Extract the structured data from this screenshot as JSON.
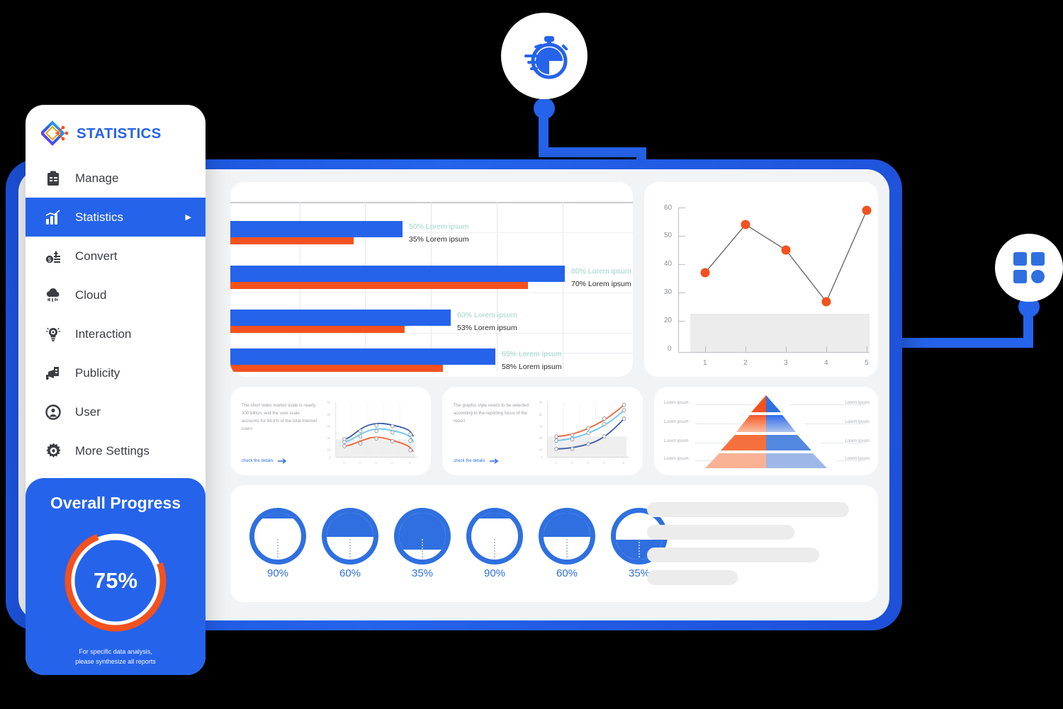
{
  "brand": {
    "name": "STATISTICS",
    "logo_icon": "diamond-circuit-logo"
  },
  "sidebar": {
    "items": [
      {
        "label": "Manage",
        "icon": "clipboard-icon",
        "active": false
      },
      {
        "label": "Statistics",
        "icon": "bar-chart-icon",
        "active": true
      },
      {
        "label": "Convert",
        "icon": "exchange-money-icon",
        "active": false
      },
      {
        "label": "Cloud",
        "icon": "cloud-rain-icon",
        "active": false
      },
      {
        "label": "Interaction",
        "icon": "lightbulb-gear-icon",
        "active": false
      },
      {
        "label": "Publicity",
        "icon": "megaphone-chart-icon",
        "active": false
      },
      {
        "label": "User",
        "icon": "user-circle-icon",
        "active": false
      },
      {
        "label": "More Settings",
        "icon": "gear-icon",
        "active": false
      }
    ],
    "progress": {
      "title": "Overall Progress",
      "value": "75%",
      "percent": 75,
      "note_line1": "For specific data analysis,",
      "note_line2": "please synthesize all reports",
      "ring_color": "#f4511e",
      "track_color": "#ffffff"
    }
  },
  "badges": [
    {
      "name": "stopwatch-icon",
      "position": "top"
    },
    {
      "name": "grid-apps-icon",
      "position": "right"
    }
  ],
  "colors": {
    "brand_blue": "#2563eb",
    "frame_blue": "#1b4fd6",
    "accent_orange": "#f4511e",
    "screen_bg": "#f2f3f5"
  },
  "chart_data": [
    {
      "type": "bar",
      "orientation": "horizontal",
      "title": "",
      "grid": true,
      "series": [
        {
          "name": "primary",
          "color": "#2563eb",
          "values": [
            50,
            80,
            60,
            65
          ]
        },
        {
          "name": "secondary",
          "color": "#f4511e",
          "values": [
            35,
            70,
            53,
            58
          ]
        }
      ],
      "labels_top": [
        "50% Lorem ipsum",
        "80% Lorem ipsum",
        "60% Lorem ipsum",
        "65% Lorem ipsum"
      ],
      "labels_bottom": [
        "35% Lorem ipsum",
        "70% Lorem ipsum",
        "53% Lorem ipsum",
        "58% Lorem ipsum"
      ],
      "xlim": [
        0,
        100
      ]
    },
    {
      "type": "line",
      "title": "",
      "x": [
        1,
        2,
        3,
        4,
        5
      ],
      "values": [
        30,
        50,
        40,
        21,
        57
      ],
      "marker_color": "#f4511e",
      "line_color": "#6b6b6b",
      "yticks": [
        "0",
        "20",
        "30",
        "40",
        "50",
        "60"
      ],
      "xticks": [
        "1",
        "2",
        "3",
        "4",
        "5"
      ],
      "ylim": [
        0,
        60
      ],
      "band": {
        "from": 4,
        "to": 25
      }
    },
    {
      "type": "line",
      "title": "",
      "x": [
        1,
        2,
        3,
        4,
        5
      ],
      "series": [
        {
          "name": "series-a",
          "color": "#3f5fae",
          "values": [
            32,
            42,
            48,
            47,
            38
          ]
        },
        {
          "name": "series-b",
          "color": "#6fc6ef",
          "values": [
            28,
            36,
            44,
            42,
            33
          ]
        },
        {
          "name": "series-c",
          "color": "#ef6a3c",
          "values": [
            26,
            29,
            35,
            31,
            22
          ]
        }
      ],
      "yticks": [
        "0",
        "20",
        "30",
        "40",
        "50",
        "60"
      ],
      "xticks": [
        "1",
        "2",
        "3",
        "4",
        "5"
      ]
    },
    {
      "type": "line",
      "title": "",
      "x": [
        1,
        2,
        3,
        4,
        5
      ],
      "series": [
        {
          "name": "series-a",
          "color": "#ef6a3c",
          "values": [
            22,
            24,
            33,
            44,
            58
          ]
        },
        {
          "name": "series-b",
          "color": "#6fc6ef",
          "values": [
            18,
            20,
            27,
            38,
            52
          ]
        },
        {
          "name": "series-c",
          "color": "#3f5fae",
          "values": [
            10,
            10,
            16,
            26,
            46
          ]
        }
      ],
      "yticks": [
        "0",
        "20",
        "30",
        "40",
        "50",
        "60"
      ],
      "xticks": [
        "1",
        "2",
        "3",
        "4",
        "5"
      ]
    },
    {
      "type": "pie",
      "subtype": "pyramid",
      "levels": 4,
      "left_color": "#f4511e",
      "right_color": "#2563eb",
      "left_labels": [
        "Lorem ipsum",
        "Lorem ipsum",
        "Lorem ipsum",
        "Lorem ipsum"
      ],
      "right_labels": [
        "Lorem ipsum",
        "Lorem ipsum",
        "Lorem ipsum",
        "Lorem ipsum"
      ]
    },
    {
      "type": "bar",
      "subtype": "circle-gauges",
      "categories": [
        "g1",
        "g2",
        "g3",
        "g4",
        "g5",
        "g6"
      ],
      "values": [
        90,
        60,
        35,
        90,
        60,
        35
      ],
      "labels": [
        "90%",
        "60%",
        "35%",
        "90%",
        "60%",
        "35%"
      ],
      "color": "#2f6fe0"
    }
  ],
  "mini_cards": [
    {
      "text": "The short video market scale is nearly 300 billion, and the user scale accounts for 94.8% of the total Internet users",
      "link": "check the details"
    },
    {
      "text": "The graphic style needs to be selected according to the reporting focus of the report",
      "link": "check the details"
    }
  ],
  "skeleton_rows": 4
}
